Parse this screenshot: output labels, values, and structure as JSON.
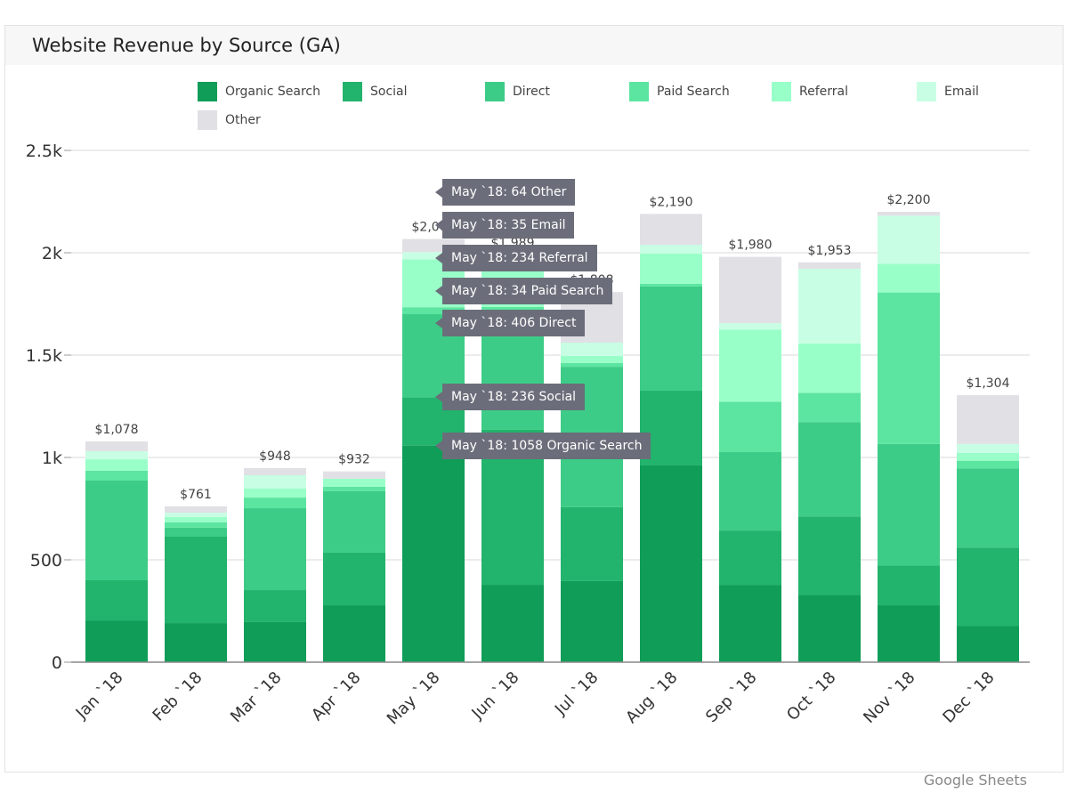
{
  "chart_data": {
    "type": "bar",
    "stacked": true,
    "title": "Website Revenue by Source (GA)",
    "categories": [
      "Jan `18",
      "Feb `18",
      "Mar `18",
      "Apr `18",
      "May `18",
      "Jun `18",
      "Jul `18",
      "Aug `18",
      "Sep `18",
      "Oct `18",
      "Nov `18",
      "Dec `18"
    ],
    "totals_labels": [
      "$1,078",
      "$761",
      "$948",
      "$932",
      "$2,067",
      "$1,989",
      "$1,808",
      "$2,190",
      "$1,980",
      "$1,953",
      "$2,200",
      "$1,304"
    ],
    "series": [
      {
        "name": "Organic Search",
        "color": "#0f9d58",
        "values": [
          204,
          191,
          196,
          278,
          1058,
          378,
          396,
          961,
          376,
          328,
          278,
          176
        ]
      },
      {
        "name": "Social",
        "color": "#22b36c",
        "values": [
          196,
          422,
          156,
          257,
          236,
          757,
          361,
          365,
          267,
          384,
          194,
          384
        ]
      },
      {
        "name": "Direct",
        "color": "#3dcc87",
        "values": [
          487,
          44,
          400,
          300,
          406,
          560,
          686,
          509,
          383,
          460,
          594,
          386
        ]
      },
      {
        "name": "Paid Search",
        "color": "#5ce5a0",
        "values": [
          48,
          26,
          52,
          22,
          34,
          40,
          18,
          13,
          246,
          144,
          740,
          38
        ]
      },
      {
        "name": "Referral",
        "color": "#99ffc8",
        "values": [
          56,
          26,
          44,
          39,
          234,
          200,
          35,
          148,
          353,
          241,
          140,
          38
        ]
      },
      {
        "name": "Email",
        "color": "#c8ffe4",
        "values": [
          39,
          21,
          65,
          0,
          35,
          30,
          65,
          43,
          31,
          365,
          235,
          44
        ]
      },
      {
        "name": "Other",
        "color": "#e0e0e5",
        "values": [
          48,
          31,
          35,
          36,
          64,
          24,
          247,
          151,
          324,
          31,
          19,
          238
        ]
      }
    ],
    "ylim": [
      0,
      2500
    ],
    "yticks": [
      0,
      500,
      1000,
      1500,
      2000,
      2500
    ],
    "ytick_labels": [
      "0",
      "500",
      "1k",
      "1.5k",
      "2k",
      "2.5k"
    ],
    "grid": true,
    "legend_position": "top",
    "tooltips": [
      "May `18: 64 Other",
      "May `18: 35 Email",
      "May `18: 234 Referral",
      "May `18: 34 Paid Search",
      "May `18: 406 Direct",
      "May `18: 236 Social",
      "May `18: 1058 Organic Search"
    ]
  },
  "footer": "Google Sheets"
}
